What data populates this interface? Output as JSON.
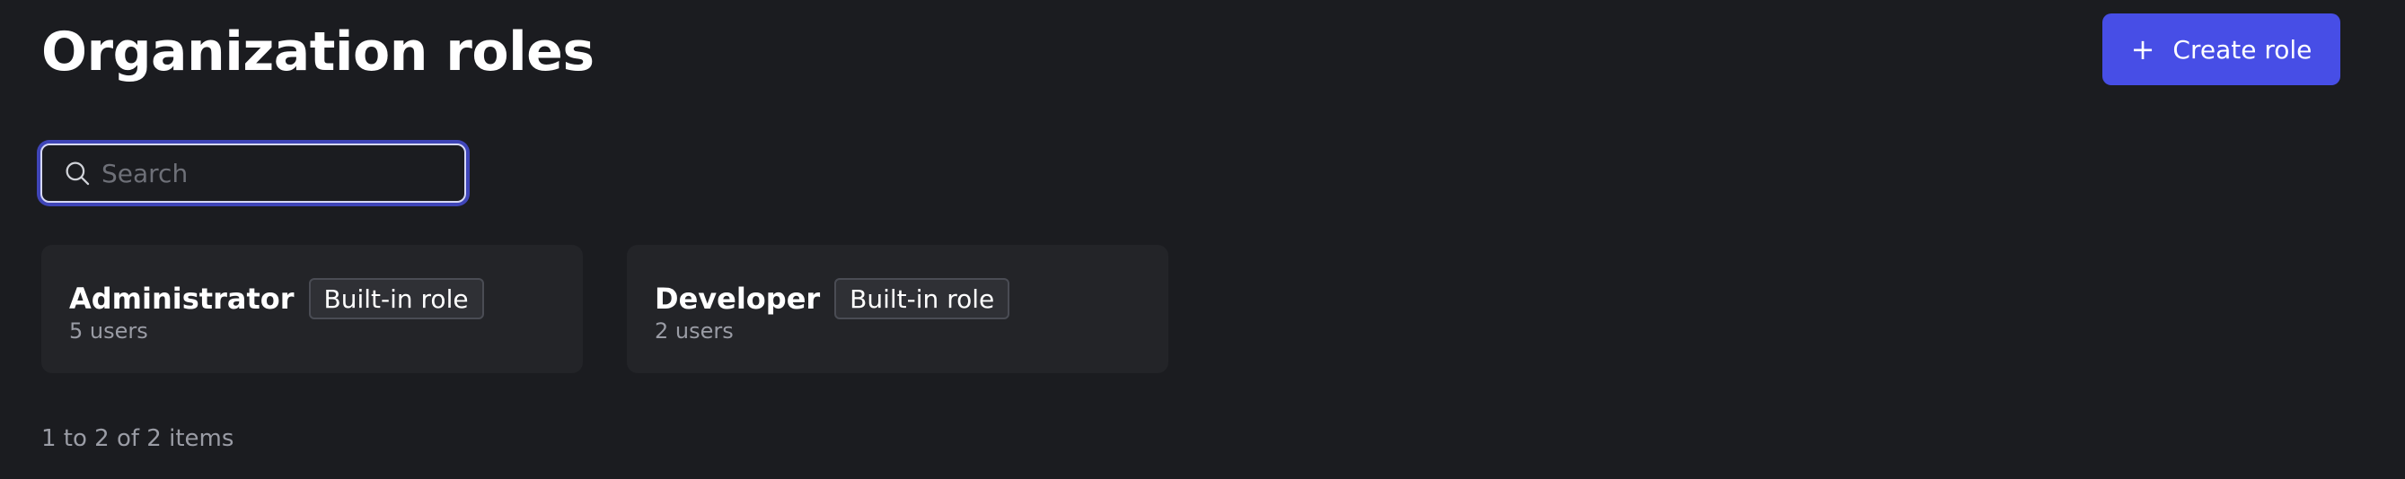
{
  "header": {
    "title": "Organization roles",
    "create_button": {
      "icon": "plus-icon",
      "icon_glyph": "+",
      "label": "Create role"
    }
  },
  "search": {
    "icon": "search-icon",
    "placeholder": "Search",
    "value": ""
  },
  "roles": [
    {
      "name": "Administrator",
      "badge": "Built-in role",
      "users": "5 users"
    },
    {
      "name": "Developer",
      "badge": "Built-in role",
      "users": "2 users"
    }
  ],
  "pagination": {
    "summary": "1 to 2 of 2 items"
  },
  "colors": {
    "background": "#1b1c20",
    "card": "#232428",
    "accent": "#474ee6",
    "focus_ring": "#3f45b8",
    "muted_text": "#9a9ca5"
  }
}
